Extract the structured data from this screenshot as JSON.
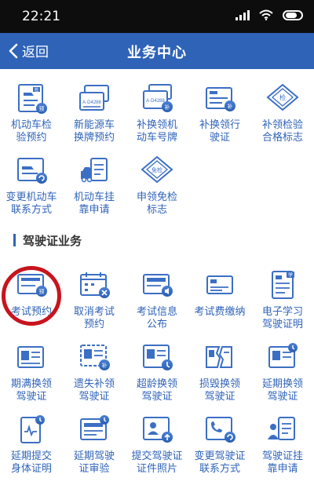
{
  "status_bar": {
    "time": "22:21"
  },
  "header": {
    "back_label": "返回",
    "title": "业务中心"
  },
  "vehicle_services": [
    {
      "line1": "机动车检",
      "line2": "验预约",
      "icon": "vehicle-inspection-appointment-icon"
    },
    {
      "line1": "新能源车",
      "line2": "换牌预约",
      "icon": "new-energy-plate-icon"
    },
    {
      "line1": "补换领机",
      "line2": "动车号牌",
      "icon": "plate-replacement-icon"
    },
    {
      "line1": "补换领行",
      "line2": "驶证",
      "icon": "driving-license-replacement-icon"
    },
    {
      "line1": "补领检验",
      "line2": "合格标志",
      "icon": "inspection-mark-icon"
    },
    {
      "line1": "变更机动车",
      "line2": "联系方式",
      "icon": "change-vehicle-contact-icon"
    },
    {
      "line1": "机动车挂",
      "line2": "靠申请",
      "icon": "vehicle-affiliation-icon"
    },
    {
      "line1": "申领免检",
      "line2": "标志",
      "icon": "exemption-mark-icon"
    }
  ],
  "section": {
    "title": "驾驶证业务"
  },
  "license_services": [
    {
      "line1": "考试预约",
      "line2": "",
      "icon": "exam-appointment-icon"
    },
    {
      "line1": "取消考试",
      "line2": "预约",
      "icon": "cancel-exam-icon"
    },
    {
      "line1": "考试信息",
      "line2": "公布",
      "icon": "exam-info-icon"
    },
    {
      "line1": "考试费缴纳",
      "line2": "",
      "icon": "exam-fee-icon"
    },
    {
      "line1": "电子学习",
      "line2": "驾驶证明",
      "icon": "e-learning-certificate-icon"
    },
    {
      "line1": "期满换领",
      "line2": "驾驶证",
      "icon": "expiry-renewal-icon"
    },
    {
      "line1": "遗失补领",
      "line2": "驾驶证",
      "icon": "lost-reissue-icon"
    },
    {
      "line1": "超龄换领",
      "line2": "驾驶证",
      "icon": "overage-renewal-icon"
    },
    {
      "line1": "损毁换领",
      "line2": "驾驶证",
      "icon": "damaged-renewal-icon"
    },
    {
      "line1": "延期换领",
      "line2": "驾驶证",
      "icon": "deferred-renewal-icon"
    },
    {
      "line1": "延期提交",
      "line2": "身体证明",
      "icon": "deferred-health-proof-icon"
    },
    {
      "line1": "延期驾驶",
      "line2": "证审验",
      "icon": "deferred-license-review-icon"
    },
    {
      "line1": "提交驾驶证",
      "line2": "证件照片",
      "icon": "submit-license-photo-icon"
    },
    {
      "line1": "变更驾驶证",
      "line2": "联系方式",
      "icon": "change-license-contact-icon"
    },
    {
      "line1": "驾驶证挂",
      "line2": "靠申请",
      "icon": "license-affiliation-icon"
    }
  ],
  "badges": {
    "inspect": "检",
    "plate_a": "A·D4288",
    "plate_b": "A·D4288",
    "supplement": "补",
    "exempt": "免检",
    "exam": "预",
    "study": "学"
  },
  "colors": {
    "primary": "#2f63b8",
    "icon_blue": "#3b6fc4",
    "accent_red": "#c8141d"
  }
}
